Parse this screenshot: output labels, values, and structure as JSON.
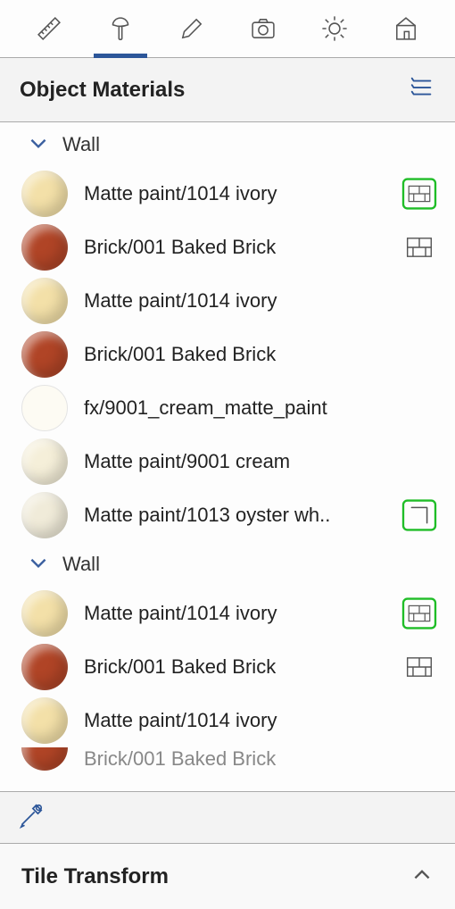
{
  "panel": {
    "title": "Object Materials"
  },
  "footer": {
    "title": "Tile Transform"
  },
  "groups": [
    {
      "name": "Wall",
      "items": [
        {
          "label": "Matte paint/1014 ivory",
          "swatch": "#f3e0a8",
          "flat": false,
          "badge": "brick-green"
        },
        {
          "label": "Brick/001 Baked Brick",
          "swatch": "#b04426",
          "flat": false,
          "badge": "brick"
        },
        {
          "label": "Matte paint/1014 ivory",
          "swatch": "#f3e0a8",
          "flat": false,
          "badge": ""
        },
        {
          "label": "Brick/001 Baked Brick",
          "swatch": "#b04426",
          "flat": false,
          "badge": ""
        },
        {
          "label": "fx/9001_cream_matte_paint",
          "swatch": "#fdfbf3",
          "flat": true,
          "badge": ""
        },
        {
          "label": "Matte paint/9001 cream",
          "swatch": "#f5efd9",
          "flat": false,
          "badge": ""
        },
        {
          "label": "Matte paint/1013 oyster wh..",
          "swatch": "#f0ebd9",
          "flat": false,
          "badge": "corner-green"
        }
      ]
    },
    {
      "name": "Wall",
      "items": [
        {
          "label": "Matte paint/1014 ivory",
          "swatch": "#f3e0a8",
          "flat": false,
          "badge": "brick-green"
        },
        {
          "label": "Brick/001 Baked Brick",
          "swatch": "#b04426",
          "flat": false,
          "badge": "brick"
        },
        {
          "label": "Matte paint/1014 ivory",
          "swatch": "#f3e0a8",
          "flat": false,
          "badge": ""
        }
      ],
      "partial": {
        "label": "Brick/001 Baked Brick",
        "swatch": "#b04426"
      }
    }
  ]
}
